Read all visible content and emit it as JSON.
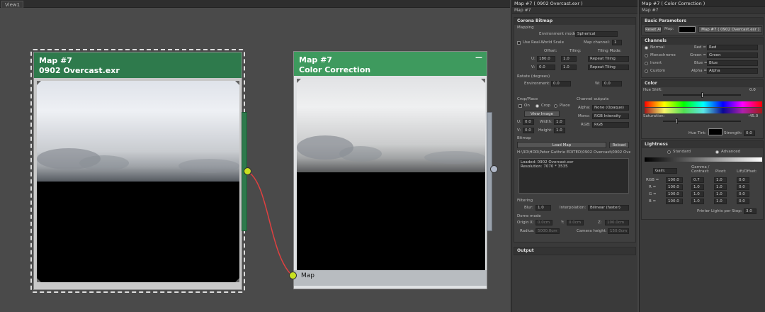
{
  "view": {
    "tab": "View1"
  },
  "node1": {
    "title": "Map #7",
    "subtitle": "0902 Overcast.exr"
  },
  "node2": {
    "title": "Map #7",
    "subtitle": "Color Correction",
    "collapse": "—",
    "footer": "Map"
  },
  "panel1": {
    "title": "Map #7 ( 0902 Overcast.exr )",
    "sub": "Map #7",
    "coronaBitmap": {
      "head": "Corona Bitmap",
      "mapping": "Mapping",
      "envModeLabel": "Environment mode:",
      "envMode": "Spherical",
      "useRealWorld": "Use Real-World Scale",
      "mapChannelLabel": "Map channel:",
      "mapChannel": "1",
      "offset": "Offset:",
      "tiling": "Tiling:",
      "tilingMode": "Tiling Mode:",
      "uLabel": "U:",
      "uOffset": "180.0",
      "uTiling": "1.0",
      "uMode": "Repeat Tiling",
      "vLabel": "V:",
      "vOffset": "0.0",
      "vTiling": "1.0",
      "vMode": "Repeat Tiling",
      "rotate": "Rotate (degrees)",
      "envLabel": "Environment:",
      "envValue": "0.0",
      "wLabel": "W:",
      "wValue": "0.0"
    },
    "crop": {
      "label": "Crop/Place",
      "on": "On",
      "crop": "Crop",
      "place": "Place",
      "viewImage": "View Image",
      "u": "U:",
      "uVal": "0.0",
      "width": "Width:",
      "widthVal": "1.0",
      "v": "V:",
      "vVal": "0.0",
      "height": "Height:",
      "heightVal": "1.0"
    },
    "channelOutputs": {
      "label": "Channel outputs",
      "alpha": "Alpha:",
      "alphaVal": "None (Opaque)",
      "mono": "Mono:",
      "monoVal": "RGB Intensity",
      "rgb": "RGB:",
      "rgbVal": "RGB"
    },
    "bitmap": {
      "label": "Bitmap",
      "loadMap": "Load Map",
      "reload": "Reload",
      "path": "H:\\3D\\HDR\\Peter Guthrie EDITED\\0902 Overcast\\0902 Overca",
      "info1": "Loaded: 0902 Overcast.exr",
      "info2": "Resolution: 7070 * 3535"
    },
    "filtering": {
      "label": "Filtering",
      "blur": "Blur:",
      "blurVal": "1.0",
      "interp": "Interpolation:",
      "interpVal": "Bilinear (faster)"
    },
    "dome": {
      "label": "Dome mode",
      "origin": "Origin",
      "x": "X:",
      "xVal": "0.0cm",
      "y": "Y:",
      "yVal": "0.0cm",
      "z": "Z:",
      "zVal": "100.0cm",
      "radius": "Radius:",
      "radiusVal": "5000.0cm",
      "camHeight": "Camera height:",
      "camVal": "150.0cm"
    },
    "output": "Output"
  },
  "panel2": {
    "title": "Map #7 ( Color Correction )",
    "sub": "Map #7",
    "basic": {
      "head": "Basic Parameters",
      "reset": "Reset All",
      "mapLabel": "Map:",
      "mapBtn": "Map #7 ( 0902 Overcast.exr )"
    },
    "channels": {
      "head": "Channels",
      "normal": "Normal",
      "mono": "Monochrome",
      "invert": "Invert",
      "custom": "Custom",
      "red": "Red =",
      "redVal": "Red",
      "green": "Green =",
      "greenVal": "Green",
      "blue": "Blue =",
      "blueVal": "Blue",
      "alpha": "Alpha =",
      "alphaVal": "Alpha"
    },
    "color": {
      "head": "Color",
      "hueShift": "Hue Shift:",
      "hueVal": "0.0",
      "saturation": "Saturation:",
      "satVal": "-45.0",
      "hueTint": "Hue Tint:",
      "strength": "Strength:",
      "strengthVal": "0.0"
    },
    "lightness": {
      "head": "Lightness",
      "standard": "Standard",
      "advanced": "Advanced",
      "gain": "Gain:",
      "gamma": "Gamma / Contrast:",
      "pivot": "Pivot:",
      "lift": "Lift/Offset:",
      "rowLabels": [
        "RGB =",
        "R =",
        "G =",
        "B ="
      ],
      "gainVals": [
        "100.0",
        "100.0",
        "100.0",
        "100.0"
      ],
      "gammaVals": [
        "0.7",
        "1.0",
        "1.0",
        "1.0"
      ],
      "pivotVals": [
        "1.0",
        "1.0",
        "1.0",
        "1.0"
      ],
      "liftVals": [
        "0.0",
        "0.0",
        "0.0",
        "0.0"
      ],
      "printer": "Printer Lights per Stop:",
      "printerVal": "3.0"
    }
  },
  "colors": {
    "nodeHeader": "#2e7a4c",
    "wireRed": "#e04040",
    "socketYellow": "#c8e020",
    "socketGray": "#b0b8c8"
  }
}
